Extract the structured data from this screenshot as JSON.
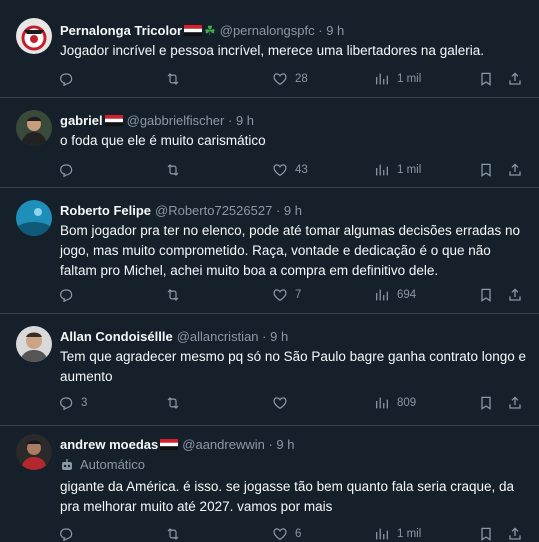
{
  "tweets": [
    {
      "name": "Pernalonga Tricolor",
      "handle": "@pernalongspfc",
      "time": "· 9 h",
      "text": "Jogador incrível e pessoa incrível, merece uma libertadores na galeria.",
      "replies": "",
      "likes": "28",
      "views": "1 mil"
    },
    {
      "name": "gabriel",
      "handle": "@gabbrielfischer",
      "time": "· 9 h",
      "text": "o foda que ele é muito carismático",
      "replies": "",
      "likes": "43",
      "views": "1 mil"
    },
    {
      "name": "Roberto Felipe",
      "handle": "@Roberto72526527",
      "time": "· 9 h",
      "text": "Bom jogador pra ter no elenco, pode até tomar algumas decisões erradas no jogo, mas muito comprometido. Raça, vontade e dedicação é o que não faltam pro Michel, achei muito boa a compra em definitivo dele.",
      "replies": "",
      "likes": "7",
      "views": "694"
    },
    {
      "name": "Allan Condoiséllle",
      "handle": "@allancristian",
      "time": "· 9 h",
      "text": "Tem que agradecer mesmo pq só no São Paulo bagre ganha contrato longo e aumento",
      "replies": "3",
      "likes": "",
      "views": "809"
    },
    {
      "name": "andrew moedas",
      "handle": "@aandrewwin",
      "time": "· 9 h",
      "automated": "Automático",
      "text": "gigante da América. é isso. se jogasse tão bem quanto fala seria craque, da pra melhorar muito até 2027. vamos por mais",
      "replies": "",
      "likes": "6",
      "views": "1 mil"
    }
  ],
  "colors": {
    "background": "#15202b",
    "divider": "#38444d",
    "muted": "#8b98a5",
    "text": "#f7f9f9"
  }
}
